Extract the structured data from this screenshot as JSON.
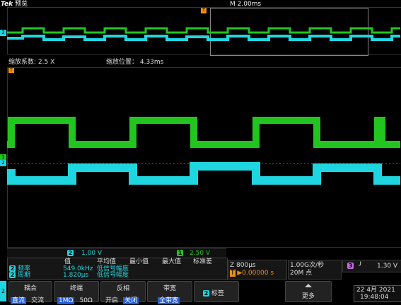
{
  "header": {
    "brand": "Tek",
    "mode": "预览",
    "timebase": "M 2.00ms"
  },
  "zoom": {
    "factor_label": "缩放系数: 2.5 X",
    "position_label": "缩放位置： 4.33ms"
  },
  "channels": {
    "ch1_marker": "1",
    "ch2_marker": "2",
    "ch1_scale": "2.50 V",
    "ch2_scale": "1.00 V",
    "ch1_color": "#22c51f",
    "ch2_color": "#1fd6e0"
  },
  "measurements": {
    "headers": [
      "值",
      "平均值",
      "最小值",
      "最大值",
      "标准差"
    ],
    "rows": [
      {
        "ch": "2",
        "name": "频率",
        "value": "549.0kHz",
        "mean": "低信号幅度"
      },
      {
        "ch": "2",
        "name": "周期",
        "value": "1.820μs",
        "mean": "低信号幅度"
      }
    ]
  },
  "horizontal": {
    "scale": "Z 800μs",
    "trigger_pos": "▶0.00000 s",
    "trigger_chip": "T"
  },
  "acquisition": {
    "rate": "1.00G次/秒",
    "points": "20M 点"
  },
  "trigger": {
    "channel": "3",
    "slope_icon": "rising-edge",
    "level": "1.30 V"
  },
  "menu": {
    "side_number": "2",
    "coupling_label": "耦合",
    "coupling_dc": "直流",
    "coupling_ac": "交流",
    "termination_label": "终端",
    "term_1m": "1MΩ",
    "term_50": "50Ω",
    "invert_label": "反相",
    "invert_on": "开启",
    "invert_off": "关闭",
    "bandwidth_label": "带宽",
    "bandwidth_value": "全带宽",
    "label_chip": "2",
    "label_text": "标签",
    "more_label": "更多"
  },
  "datetime": {
    "date": "22 4月  2021",
    "time": "19:48:04"
  }
}
